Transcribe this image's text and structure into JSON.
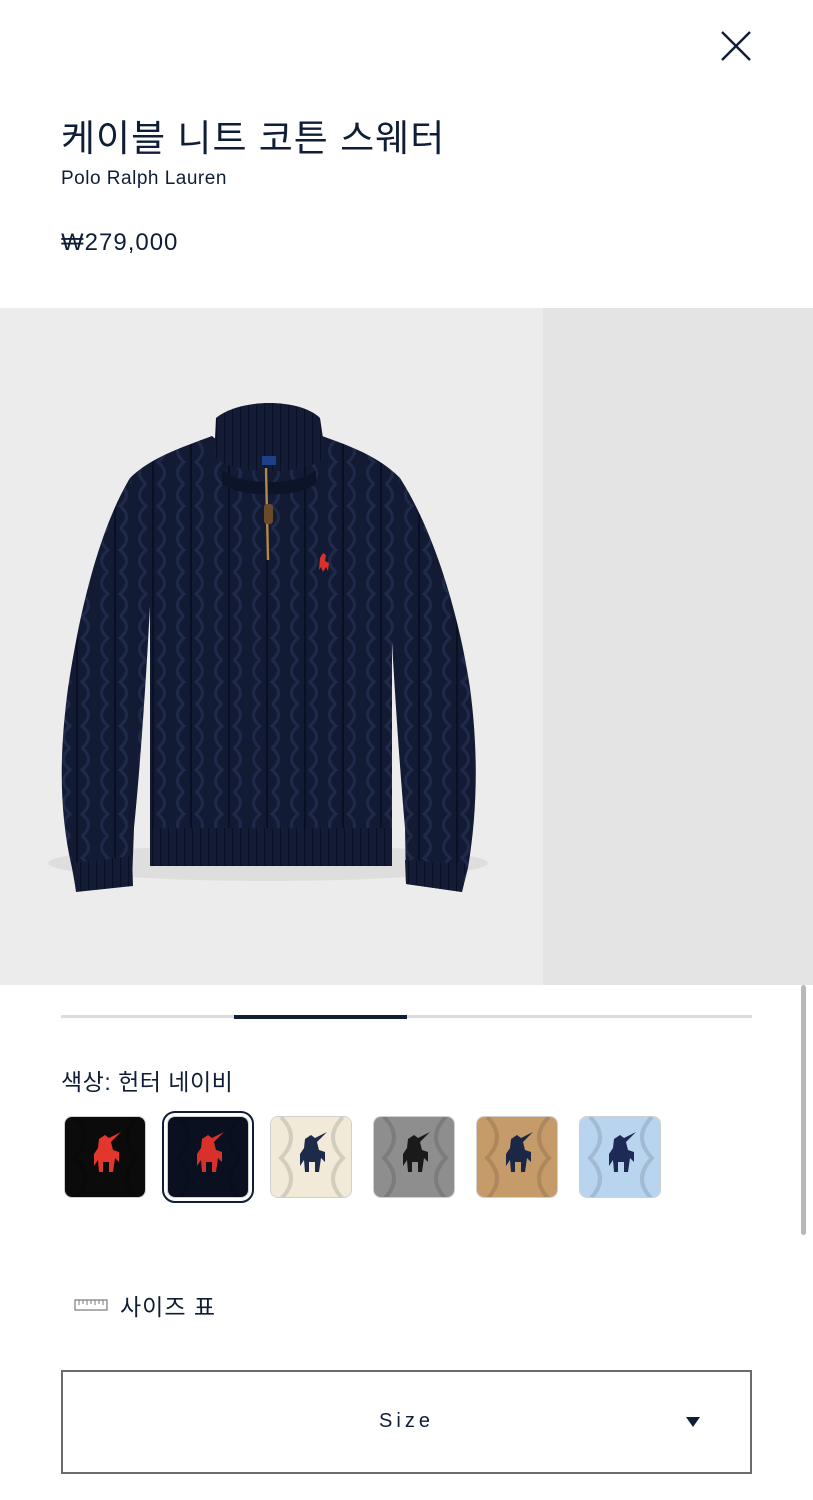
{
  "product": {
    "title": "케이블 니트 코튼 스웨터",
    "brand": "Polo Ralph Lauren",
    "price": "₩279,000"
  },
  "gallery": {
    "main_image": "navy-cable-knit-quarter-zip-sweater",
    "slide_progress": {
      "segments": 4,
      "active_index": 1
    }
  },
  "color": {
    "label": "색상: 헌터 네이비",
    "swatches": [
      {
        "name": "black-red-pony",
        "background": "#0b0b0b",
        "pony": "#e3372d"
      },
      {
        "name": "hunter-navy",
        "background": "#0a1020",
        "pony": "#d8302a",
        "selected": true
      },
      {
        "name": "cream",
        "background": "#f1ead8",
        "pony": "#1d2a4a"
      },
      {
        "name": "grey-heather",
        "background": "#8e8e8e",
        "pony": "#1a1a1a"
      },
      {
        "name": "camel",
        "background": "#c69b6a",
        "pony": "#1c2745"
      },
      {
        "name": "light-blue",
        "background": "#b9d4ef",
        "pony": "#1c2a55"
      }
    ]
  },
  "size_chart": {
    "label": "사이즈 표",
    "icon": "ruler-icon"
  },
  "size_select": {
    "label": "Size",
    "icon": "caret-down-icon"
  },
  "colors": {
    "ink": "#0f1e36",
    "sweater": "#121a33",
    "pony_red": "#d8302a"
  }
}
